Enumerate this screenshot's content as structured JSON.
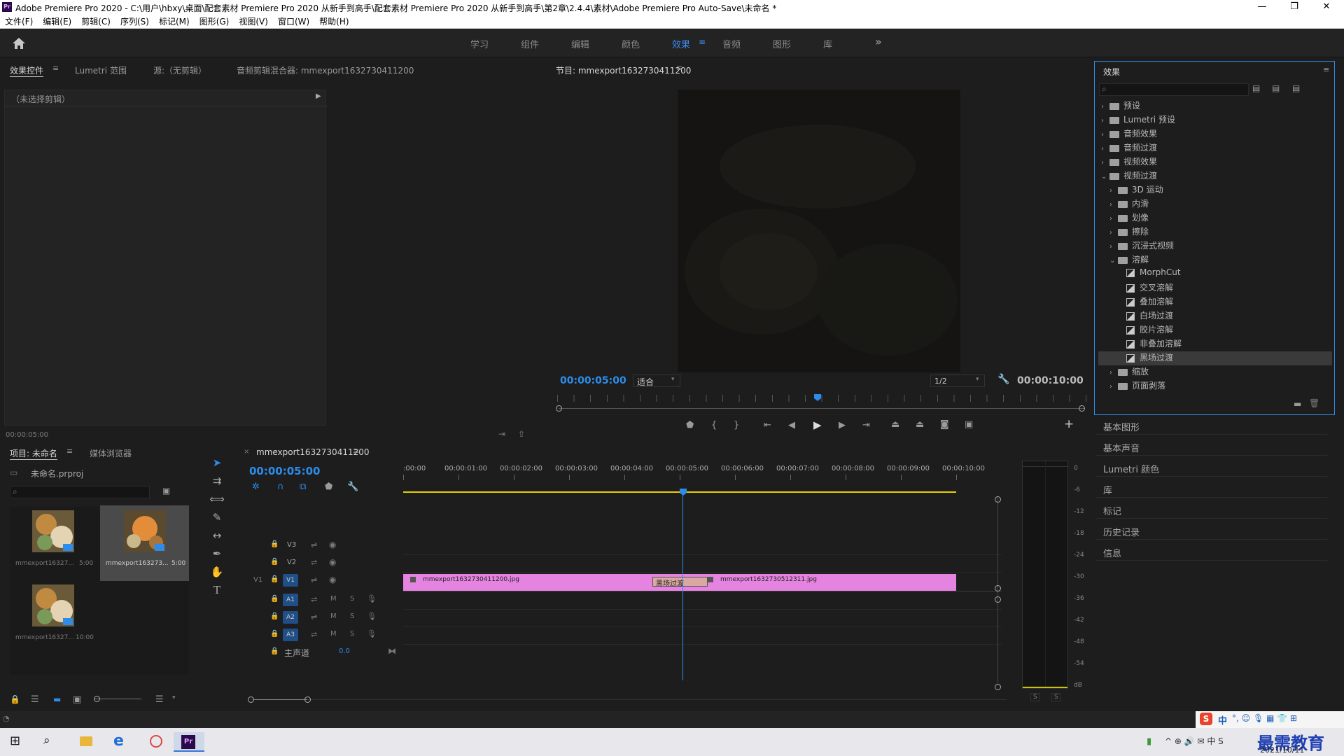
{
  "window": {
    "title": "Adobe Premiere Pro 2020 - C:\\用户\\hbxy\\桌面\\配套素材 Premiere Pro 2020 从新手到高手\\配套素材 Premiere Pro 2020 从新手到高手\\第2章\\2.4.4\\素材\\Adobe Premiere Pro Auto-Save\\未命名 *",
    "logo": "Pr",
    "minimize": "—",
    "maximize": "❐",
    "close": "✕"
  },
  "menu": [
    "文件(F)",
    "编辑(E)",
    "剪辑(C)",
    "序列(S)",
    "标记(M)",
    "图形(G)",
    "视图(V)",
    "窗口(W)",
    "帮助(H)"
  ],
  "workspaces": [
    "学习",
    "组件",
    "编辑",
    "颜色",
    "效果",
    "音频",
    "图形",
    "库"
  ],
  "workspace_active": "效果",
  "workspace_more": "»",
  "source_panel": {
    "tabs": [
      "效果控件",
      "Lumetri 范围",
      "源:（无剪辑）",
      "音频剪辑混合器: mmexport1632730411200"
    ],
    "no_clip": "（未选择剪辑）",
    "timecode": "00:00:05:00"
  },
  "program": {
    "title": "节目: mmexport1632730411200",
    "timecode": "00:00:05:00",
    "fit": "适合",
    "resolution": "1/2",
    "duration": "00:00:10:00"
  },
  "effects": {
    "title": "效果",
    "search_placeholder": "",
    "tree": [
      {
        "label": "预设",
        "level": 0,
        "kind": "folder-star",
        "open": false
      },
      {
        "label": "Lumetri 预设",
        "level": 0,
        "kind": "folder-star",
        "open": false
      },
      {
        "label": "音频效果",
        "level": 0,
        "kind": "folder",
        "open": false
      },
      {
        "label": "音频过渡",
        "level": 0,
        "kind": "folder",
        "open": false
      },
      {
        "label": "视频效果",
        "level": 0,
        "kind": "folder",
        "open": false
      },
      {
        "label": "视频过渡",
        "level": 0,
        "kind": "folder",
        "open": true
      },
      {
        "label": "3D 运动",
        "level": 1,
        "kind": "folder",
        "open": false
      },
      {
        "label": "内滑",
        "level": 1,
        "kind": "folder",
        "open": false
      },
      {
        "label": "划像",
        "level": 1,
        "kind": "folder",
        "open": false
      },
      {
        "label": "擦除",
        "level": 1,
        "kind": "folder",
        "open": false
      },
      {
        "label": "沉浸式视频",
        "level": 1,
        "kind": "folder",
        "open": false
      },
      {
        "label": "溶解",
        "level": 1,
        "kind": "folder",
        "open": true
      },
      {
        "label": "MorphCut",
        "level": 2,
        "kind": "effect"
      },
      {
        "label": "交叉溶解",
        "level": 2,
        "kind": "effect"
      },
      {
        "label": "叠加溶解",
        "level": 2,
        "kind": "effect"
      },
      {
        "label": "白场过渡",
        "level": 2,
        "kind": "effect"
      },
      {
        "label": "胶片溶解",
        "level": 2,
        "kind": "effect"
      },
      {
        "label": "非叠加溶解",
        "level": 2,
        "kind": "effect"
      },
      {
        "label": "黑场过渡",
        "level": 2,
        "kind": "effect",
        "selected": true
      },
      {
        "label": "缩放",
        "level": 1,
        "kind": "folder",
        "open": false
      },
      {
        "label": "页面剥落",
        "level": 1,
        "kind": "folder",
        "open": false
      }
    ]
  },
  "side_panels": [
    "基本图形",
    "基本声音",
    "Lumetri 颜色",
    "库",
    "标记",
    "历史记录",
    "信息"
  ],
  "project": {
    "tabs": [
      "项目: 未命名",
      "媒体浏览器"
    ],
    "file": "未命名.prproj",
    "items": [
      {
        "name": "mmexport16327...",
        "duration": "5:00"
      },
      {
        "name": "mmexport163273...",
        "duration": "5:00"
      },
      {
        "name": "mmexport16327...",
        "duration": "10:00"
      }
    ]
  },
  "timeline": {
    "tab": "mmexport1632730411200",
    "timecode": "00:00:05:00",
    "ruler": [
      ":00:00",
      "00:00:01:00",
      "00:00:02:00",
      "00:00:03:00",
      "00:00:04:00",
      "00:00:05:00",
      "00:00:06:00",
      "00:00:07:00",
      "00:00:08:00",
      "00:00:09:00",
      "00:00:10:00"
    ],
    "tracks_video": [
      "V3",
      "V2",
      "V1"
    ],
    "tracks_audio": [
      "A1",
      "A2",
      "A3"
    ],
    "source_patch": "V1",
    "master": "主声道",
    "master_value": "0.0",
    "clip1": "mmexport1632730411200.jpg",
    "clip2": "mmexport1632730512311.jpg",
    "transition": "黑场过渡",
    "mute": "M",
    "solo": "S"
  },
  "meter": {
    "labels": [
      "0",
      "-6",
      "-12",
      "-18",
      "-24",
      "-30",
      "-36",
      "-42",
      "-48",
      "-54",
      "dB"
    ],
    "solo_l": "S",
    "solo_r": "S"
  },
  "taskbar": {
    "date": "2021/10/11",
    "watermark": "最需教育",
    "ime": "中"
  }
}
